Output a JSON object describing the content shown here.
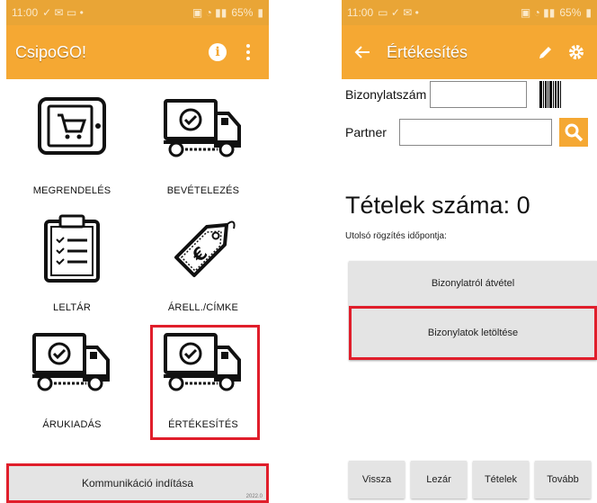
{
  "left": {
    "status": {
      "time": "11:00",
      "battery": "65%"
    },
    "appbar": {
      "title": "CsipoGO!",
      "info_icon": "info-icon",
      "menu_icon": "more-vert-icon"
    },
    "tiles": [
      {
        "label": "MEGRENDELÉS",
        "icon": "tablet-cart-icon"
      },
      {
        "label": "BEVÉTELEZÉS",
        "icon": "truck-check-icon"
      },
      {
        "label": "LELTÁR",
        "icon": "clipboard-list-icon"
      },
      {
        "label": "ÁRELL./CÍMKE",
        "icon": "price-tag-euro-icon"
      },
      {
        "label": "ÁRUKIADÁS",
        "icon": "truck-check-icon"
      },
      {
        "label": "ÉRTÉKESÍTÉS",
        "icon": "truck-check-icon"
      }
    ],
    "comm_button": "Kommunikáció indítása"
  },
  "right": {
    "status": {
      "time": "11:00",
      "battery": "65%"
    },
    "appbar": {
      "title": "Értékesítés",
      "back_icon": "arrow-back-icon",
      "edit_icon": "pencil-icon",
      "settings_icon": "gear-icon"
    },
    "doc_number_label": "Bizonylatszám",
    "doc_number_value": "",
    "partner_label": "Partner",
    "partner_value": "",
    "item_count": "Tételek száma: 0",
    "last_record_label": "Utolsó rögzítés időpontja:",
    "btn_from_doc": "Bizonylatról átvétel",
    "btn_download": "Bizonylatok letöltése",
    "bottom": {
      "back": "Vissza",
      "close": "Lezár",
      "items": "Tételek",
      "next": "Tovább"
    }
  },
  "colors": {
    "accent": "#f5a833",
    "highlight": "#e01e2b"
  }
}
